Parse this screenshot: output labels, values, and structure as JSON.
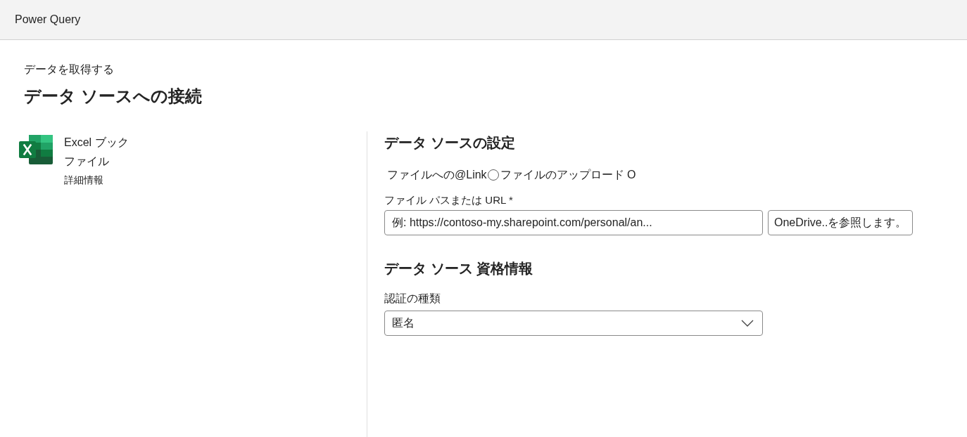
{
  "header": {
    "title": "Power Query"
  },
  "breadcrumb": "データを取得する",
  "page_title": "データ ソースへの接続",
  "connector": {
    "name": "Excel ブック",
    "category": "ファイル",
    "link": "詳細情報"
  },
  "settings": {
    "heading": "データ ソースの設定",
    "link_option": {
      "text_before": "ファイルへの@Link",
      "radio": {
        "checked": false
      },
      "text_after": "ファイルのアップロード O"
    },
    "path_field": {
      "label": "ファイル パスまたは URL *",
      "placeholder": "例: https://contoso-my.sharepoint.com/personal/an...",
      "browse_button": "OneDrive..を参照します。"
    }
  },
  "credentials": {
    "heading": "データ ソース 資格情報",
    "auth_field": {
      "label": "認証の種類",
      "value": "匿名"
    }
  }
}
